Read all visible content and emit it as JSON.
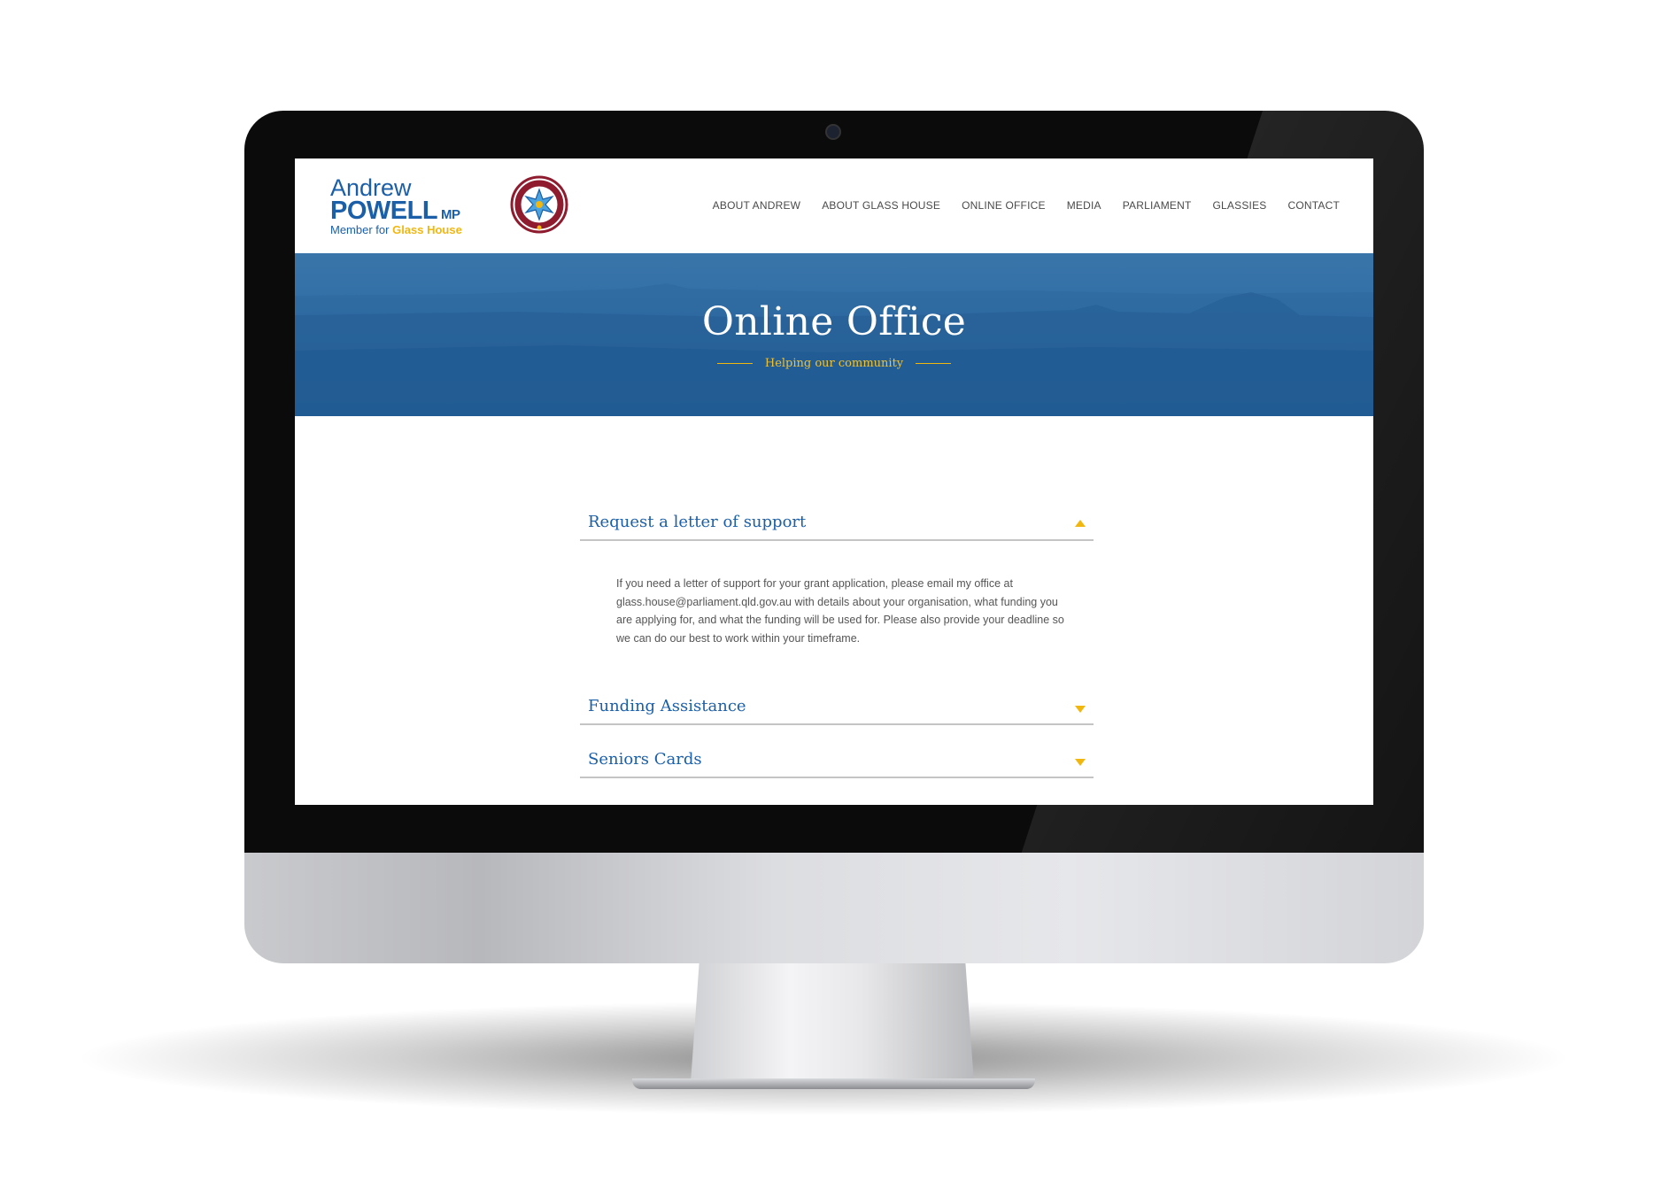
{
  "brand": {
    "first_name": "Andrew",
    "last_name": "POWELL",
    "suffix": "MP",
    "member_prefix": "Member for ",
    "electorate": "Glass House",
    "colors": {
      "primary_blue": "#1b5fa8",
      "accent_gold": "#f2b70f",
      "crest_maroon": "#8e1b2e"
    },
    "crest_icon": "queensland-parliament-crest"
  },
  "nav": {
    "items": [
      "ABOUT ANDREW",
      "ABOUT GLASS HOUSE",
      "ONLINE OFFICE",
      "MEDIA",
      "PARLIAMENT",
      "GLASSIES",
      "CONTACT"
    ]
  },
  "hero": {
    "title": "Online Office",
    "subtitle": "Helping our community"
  },
  "accordion": [
    {
      "title": "Request a letter of support",
      "expanded": true,
      "icon": "caret-up-icon",
      "body": "If you need a letter of support for your grant application, please email my office at glass.house@parliament.qld.gov.au with details about your organisation, what funding you are applying for, and what the funding will be used for. Please also provide your deadline so we can do our best to work within your timeframe."
    },
    {
      "title": "Funding Assistance",
      "expanded": false,
      "icon": "caret-down-icon"
    },
    {
      "title": "Seniors Cards",
      "expanded": false,
      "icon": "caret-down-icon"
    }
  ]
}
